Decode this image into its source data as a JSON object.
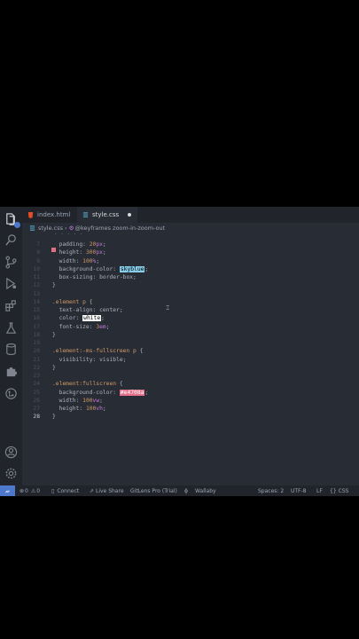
{
  "tabs": [
    {
      "label": "index.html",
      "icon": "html-file-icon",
      "active": false
    },
    {
      "label": "style.css",
      "icon": "css-file-icon",
      "active": true,
      "dirty": true
    }
  ],
  "breadcrumb": {
    "file": "style.css",
    "symbol": "@keyframes zoom-in-zoom-out"
  },
  "lines": [
    {
      "n": "7",
      "code": "  padding: 20px;"
    },
    {
      "n": "8",
      "code": "  height: 300px;"
    },
    {
      "n": "9",
      "code": "  width: 100%;"
    },
    {
      "n": "10",
      "code": "  background-color: skyblue;",
      "swatch": "skyblue",
      "swatch_color": "#87ceeb"
    },
    {
      "n": "11",
      "code": "  box-sizing: border-box;"
    },
    {
      "n": "12",
      "code": "}"
    },
    {
      "n": "13",
      "code": ""
    },
    {
      "n": "14",
      "code": ".element p {"
    },
    {
      "n": "15",
      "code": "  text-align: center;"
    },
    {
      "n": "16",
      "code": "  color: white;",
      "swatch": "white",
      "swatch_color": "#ffffff"
    },
    {
      "n": "17",
      "code": "  font-size: 3em;"
    },
    {
      "n": "18",
      "code": "}"
    },
    {
      "n": "19",
      "code": ""
    },
    {
      "n": "20",
      "code": ".element:-ms-fullscreen p {"
    },
    {
      "n": "21",
      "code": "  visibility: visible;"
    },
    {
      "n": "22",
      "code": "}"
    },
    {
      "n": "23",
      "code": ""
    },
    {
      "n": "24",
      "code": ".element:fullscreen {"
    },
    {
      "n": "25",
      "code": "  background-color: #e4708a;",
      "swatch": "#e4708a",
      "swatch_color": "#e4708a"
    },
    {
      "n": "26",
      "code": "  width: 100vw;"
    },
    {
      "n": "27",
      "code": "  height: 100vh;"
    },
    {
      "n": "28",
      "code": "}"
    }
  ],
  "status": {
    "errors": "0",
    "warnings": "0",
    "connect": "Connect",
    "live_share": "Live Share",
    "gitlens": "GitLens Pro (Trial)",
    "wallaby": "Wallaby",
    "spaces": "Spaces: 2",
    "encoding": "UTF-8",
    "eol": "LF",
    "language": "CSS"
  },
  "colors": {
    "accent": "#4d78cc",
    "editor_bg": "#282c34",
    "chrome_bg": "#21252b"
  }
}
